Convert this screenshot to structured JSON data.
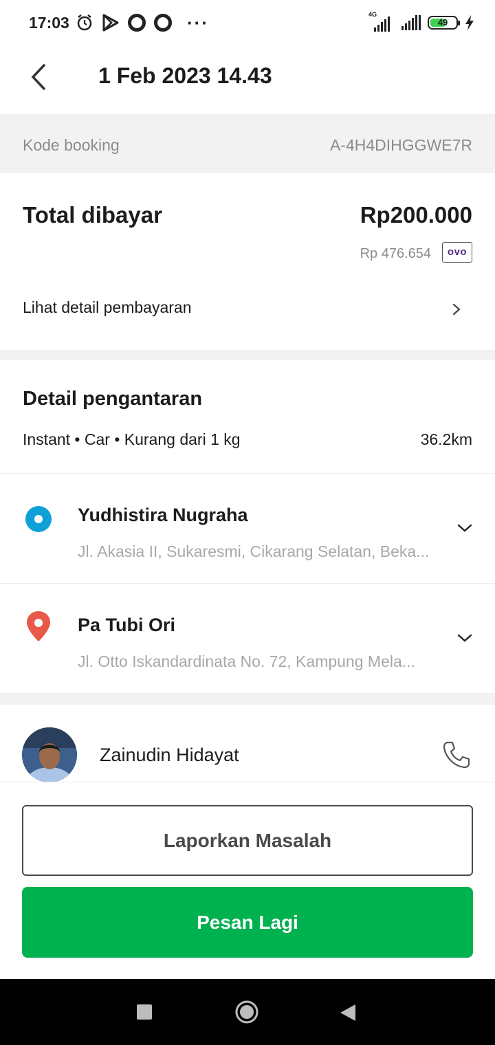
{
  "status_bar": {
    "time": "17:03",
    "network": "4G",
    "battery": "49",
    "icons": [
      "alarm-icon",
      "play-store-icon",
      "circle-icon",
      "circle-icon",
      "more-icon",
      "signal-icon",
      "signal-icon",
      "battery-icon",
      "charging-icon"
    ]
  },
  "header": {
    "title": "1 Feb 2023 14.43"
  },
  "booking": {
    "label": "Kode booking",
    "code": "A-4H4DIHGGWE7R"
  },
  "payment": {
    "total_label": "Total dibayar",
    "total_value": "Rp200.000",
    "sub_amount": "Rp 476.654",
    "method_badge": "OVO",
    "detail_link": "Lihat detail pembayaran"
  },
  "delivery": {
    "title": "Detail pengantaran",
    "meta": "Instant • Car • Kurang dari 1 kg",
    "distance": "36.2km",
    "origin": {
      "name": "Yudhistira Nugraha",
      "address": "Jl. Akasia II, Sukaresmi, Cikarang Selatan, Beka..."
    },
    "destination": {
      "name": "Pa Tubi Ori",
      "address": "Jl. Otto Iskandardinata No. 72, Kampung Mela..."
    }
  },
  "driver": {
    "name": "Zainudin Hidayat"
  },
  "actions": {
    "report_label": "Laporkan Masalah",
    "order_again_label": "Pesan Lagi"
  },
  "colors": {
    "primary_green": "#00b14f",
    "origin_blue": "#10a0d8",
    "destination_red": "#e8594a",
    "muted_text": "#8c8c8c"
  }
}
